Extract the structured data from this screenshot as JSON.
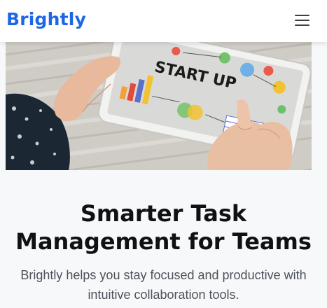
{
  "header": {
    "brand": "Brightly",
    "menu_icon": "hamburger-menu-icon",
    "brand_color": "#1f66e5"
  },
  "hero": {
    "image_text": "START UP",
    "headline": "Smarter Task Management for Teams",
    "subtext": "Brightly helps you stay focused and productive with intuitive collaboration tools."
  }
}
